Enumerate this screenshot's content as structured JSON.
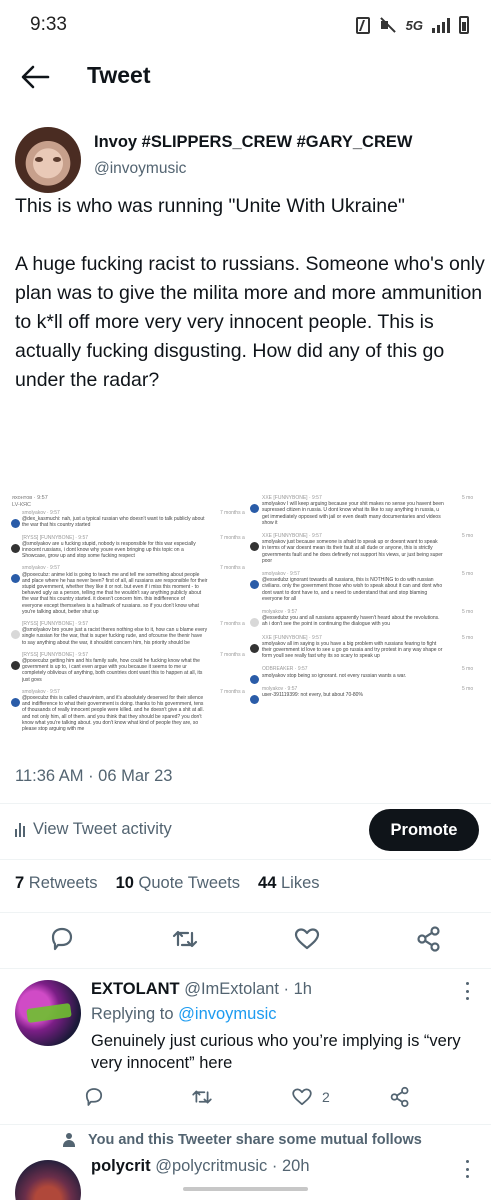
{
  "status_bar": {
    "time": "9:33",
    "network": "5G"
  },
  "header": {
    "title": "Tweet"
  },
  "tweet": {
    "author_name": "Invoy #SLIPPERS_CREW #GARY_CREW",
    "author_handle": "@invoymusic",
    "text": "This is who was running \"Unite With Ukraine\"\n\nA huge fucking racist to russians. Someone who's only plan was to give the milita more and more ammunition to k*ll off more very very innocent people. This is actually fucking disgusting. How did any of this go under the radar?",
    "timestamp": "11:36 AM · 06 Mar 23",
    "view_activity_label": "View Tweet activity",
    "promote_label": "Promote",
    "retweets_count": "7",
    "retweets_label": "Retweets",
    "quote_tweets_count": "10",
    "quote_tweets_label": "Quote Tweets",
    "likes_count": "44",
    "likes_label": "Likes"
  },
  "media": {
    "left_header": "яхонтов · 9:57\nLV-КЯС",
    "left_messages": [
      {
        "name": "smolyakov · 9:57",
        "text": "@dex_kasmuchi: nah, just a typical russian who doesn't want to talk publicly about\nthe war that his country started",
        "time": "7 months a"
      },
      {
        "name": "[RYSS] [FUNNYBONE] · 9:57",
        "text": "@smolyakov are u fucking stupid, nobody is responsible for this war especially\ninnocent russians, i dont know why youre even bringing up this topic on a\nShowcase, grow up and stop some fucking respect",
        "time": "7 months a"
      },
      {
        "name": "smolyakov · 9:57",
        "text": "@poxecubz: anime kid is going to teach me and tell me something about people\nand place where he has never been? first of all, all russians are responsible for their\nstupid government, whether they like it or not. but even if i miss this moment - to\nbehaved ugly as a person, telling me that he wouldn't say anything publicly about\nthe war that his country started. it doesn't concern him. this indifference of\neveryone except themselves is a hallmark of russians. so if you don't know what\nyou're talking about, better shut up",
        "time": "7 months a"
      },
      {
        "name": "[RYSS] [FUNNYBONE] · 9:57",
        "text": "@smolyakov bro youre just a racist theres nothing else to it, how can u blame every\nsingle russian for the war, that is super fucking rude, and ofcourse the thenir have\nto say anything about the war, it shouldnt concern him, his priority should be",
        "time": "7 months a"
      },
      {
        "name": "[RYSS] [FUNNYBONE] · 9:57",
        "text": "@poxecubz getting him and his family safe, how could he fucking know what the\ngovernment is up to, i cant even argue with you because it seems to me ur\ncompletely oblivious of anything, both countries dont want this to happen at all, its\njust govs",
        "time": "7 months a"
      },
      {
        "name": "smolyakov · 9:57",
        "text": "@poxecubz this is called chauvinism, and it's absolutely deserved for their silence\nand indifference to what their government is doing. thanks to his government, tens\nof thousands of really innocent people were killed. and he doesn't give a shit at all.\nand not only him, all of them. and you think that they should be spared? you don't\nknow what you're talking about. you don't know what kind of people they are, so\nplease stop arguing with me",
        "time": "7 months a"
      }
    ],
    "right_messages": [
      {
        "name": "XXE [FUNNYBONE] · 9:57",
        "text": "smolyakov I will keep arguing because your shit makes no sense you havent been\nsupressed citizen in russia. U dont know what its like to say anything in russia, u\nget immediately opposed with jail or even death many documentaries and videos\nshow it",
        "time": "5 mo"
      },
      {
        "name": "XXE [FUNNYBONE] · 9:57",
        "text": "smolyakov just because someone is afraid to speak up or doesnt want to speak\nin terms of war doesnt mean its their fault at all dude or anyone, this is strictly\ngovernments fault and he does definetly not support his views, ur just being super\npoor",
        "time": "5 mo"
      },
      {
        "name": "smolyakov · 9:57",
        "text": "@exsedubz ignorant towards all russians, this is NOTHING to do with russian\ncivilians. only the government those who wish to speak about it can and dont who\ndont want to dont have to, and u need to understand that and stop blaming\neveryone for all",
        "time": "5 mo"
      },
      {
        "name": "molyakov · 9:57",
        "text": "@exsedubz you and all russians apparently haven't heard about the revolutions.\nah i don't see the point in continuing the dialogue with you",
        "time": "5 mo"
      },
      {
        "name": "XXE [FUNNYBONE] · 9:57",
        "text": "smolyakov all im saying is you have a big problem with russians fearing to fight\ntheir government id love to see u go go russia and try protest in any way shape or\nform youll see really fast why its so scary to speak up",
        "time": "5 mo"
      },
      {
        "name": "ODBREAKER · 9:57",
        "text": "smolyakov stop being so ignorant. not every russian wants a war.",
        "time": "5 mo"
      },
      {
        "name": "molyakov · 9:57",
        "text": "user-391119399: not every, but about 70-80%",
        "time": "5 mo"
      }
    ]
  },
  "reply": {
    "name": "EXTOLANT",
    "handle": "@ImExtolant",
    "time": "· 1h",
    "replying_to_label": "Replying to",
    "replying_to_handle": "@invoymusic",
    "text": "Genuinely just curious who you’re implying is “very very innocent” here",
    "likes_count": "2"
  },
  "mutual_follows": {
    "text": "You and this Tweeter share some mutual follows"
  },
  "next_tweet": {
    "name": "polycrit",
    "handle": "@polycritmusic",
    "time": "· 20h"
  },
  "colors": {
    "text": "#0f1419",
    "secondary": "#536471",
    "accent": "#1d9bf0",
    "promote_bg": "#0f1419"
  },
  "icons": [
    "back-arrow-icon",
    "reply-icon",
    "retweet-icon",
    "like-icon",
    "share-icon",
    "bar-chart-icon",
    "more-icon",
    "person-icon"
  ]
}
